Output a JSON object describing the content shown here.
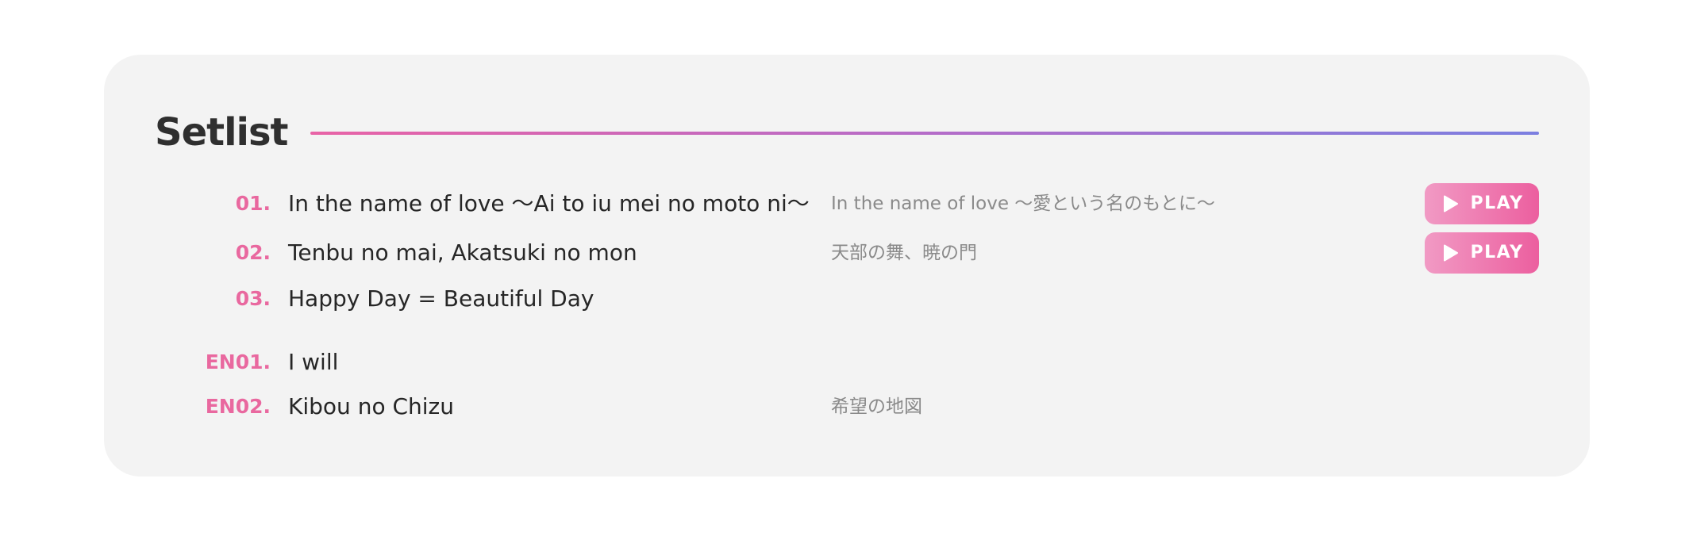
{
  "setlist": {
    "title": "Setlist",
    "accent_colors": {
      "number": "#e9689f",
      "line_start": "#e863a6",
      "line_end": "#7b7fe0",
      "button_start": "#f19ac4",
      "button_end": "#ec5f9f"
    },
    "tracks": [
      {
        "number": "01.",
        "title": "In the name of love 〜Ai to iu mei no moto ni〜",
        "japanese": "In the name of love 〜愛という名のもとに〜",
        "has_play": true,
        "play_label": "PLAY",
        "play_icon": "play-icon"
      },
      {
        "number": "02.",
        "title": "Tenbu no mai, Akatsuki no mon",
        "japanese": "天部の舞、暁の門",
        "has_play": true,
        "play_label": "PLAY",
        "play_icon": "play-icon"
      },
      {
        "number": "03.",
        "title": "Happy Day = Beautiful Day",
        "japanese": "",
        "has_play": false
      },
      {
        "number": "EN01.",
        "title": "I will",
        "japanese": "",
        "has_play": false
      },
      {
        "number": "EN02.",
        "title": "Kibou no Chizu",
        "japanese": "希望の地図",
        "has_play": false
      }
    ]
  }
}
